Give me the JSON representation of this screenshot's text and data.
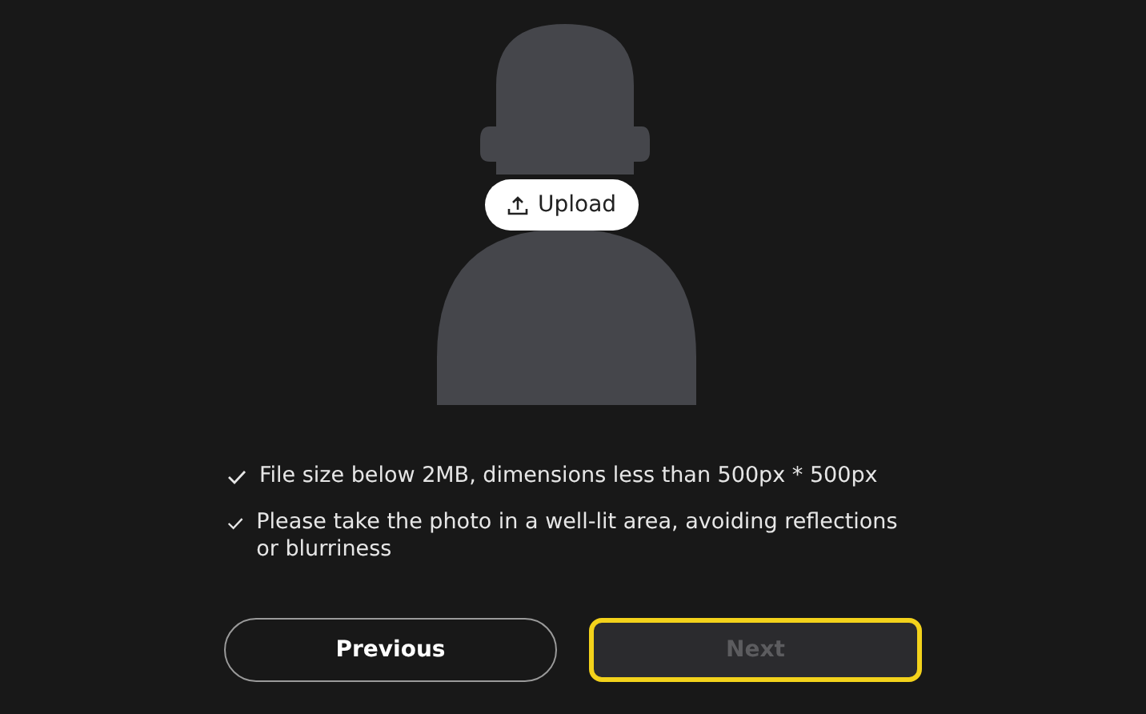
{
  "upload_button": {
    "label": "Upload"
  },
  "requirements": [
    {
      "text": "File size below 2MB, dimensions less than 500px * 500px",
      "checked": true
    },
    {
      "text": "Please take the photo in a well-lit area, avoiding reflections or blurriness",
      "checked": true
    }
  ],
  "buttons": [
    {
      "label": "Previous",
      "disabled": false,
      "highlighted": false
    },
    {
      "label": "Next",
      "disabled": true,
      "highlighted": true
    }
  ]
}
